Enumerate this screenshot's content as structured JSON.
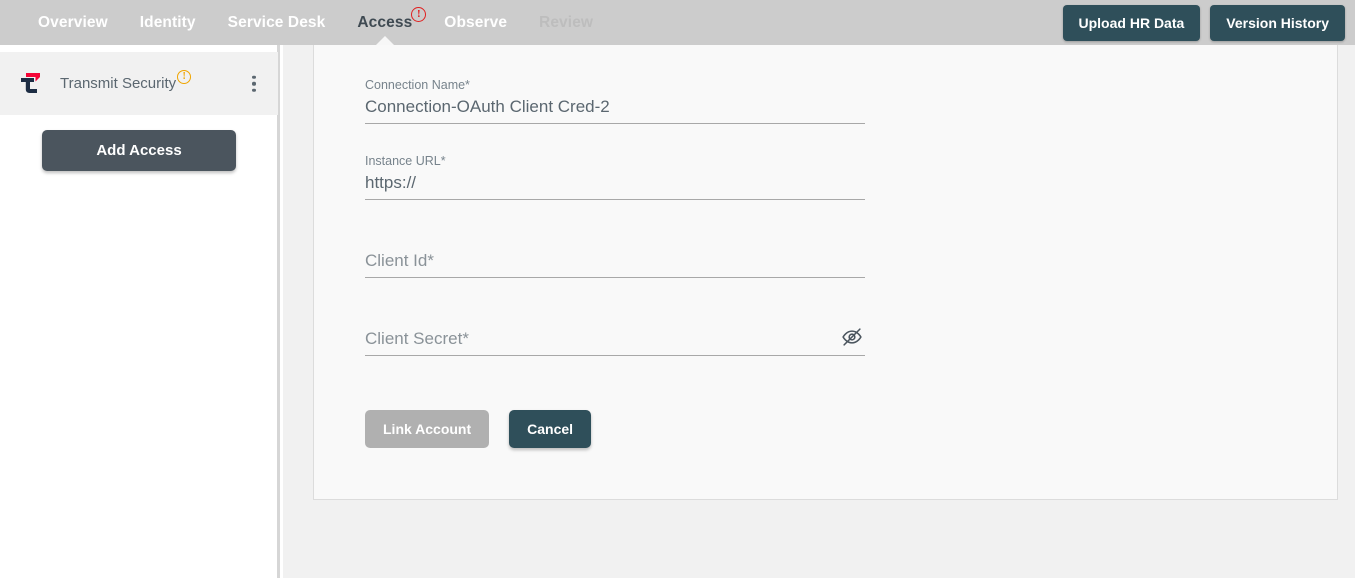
{
  "header": {
    "tabs": [
      {
        "label": "Overview",
        "state": "normal",
        "badge": null
      },
      {
        "label": "Identity",
        "state": "normal",
        "badge": null
      },
      {
        "label": "Service Desk",
        "state": "normal",
        "badge": null
      },
      {
        "label": "Access",
        "state": "active",
        "badge": "!"
      },
      {
        "label": "Observe",
        "state": "normal",
        "badge": null
      },
      {
        "label": "Review",
        "state": "muted",
        "badge": null
      }
    ],
    "upload_hr_data_label": "Upload HR Data",
    "version_history_label": "Version History",
    "background_color": "#cccccc",
    "button_color": "#2f4f5a",
    "active_tab_color": "#3f4a52",
    "badge_color": "#e02020"
  },
  "sidebar": {
    "connection": {
      "name": "Transmit Security",
      "badge": "!",
      "badge_color": "#f0a500",
      "menu_icon": "kebab-menu-icon"
    },
    "add_access_label": "Add Access",
    "add_access_color": "#4b555e"
  },
  "form": {
    "fields": [
      {
        "label": "Connection Name*",
        "value": "Connection-OAuth Client Cred-2",
        "placeholder": "",
        "filled": true,
        "has_label_above": true,
        "has_reveal_toggle": false
      },
      {
        "label": "Instance URL*",
        "value": "https://",
        "placeholder": "",
        "filled": true,
        "has_label_above": true,
        "has_reveal_toggle": false
      },
      {
        "label": "",
        "value": "",
        "placeholder": "Client Id*",
        "filled": false,
        "has_label_above": false,
        "has_reveal_toggle": false
      },
      {
        "label": "",
        "value": "",
        "placeholder": "Client Secret*",
        "filled": false,
        "has_label_above": false,
        "has_reveal_toggle": true
      }
    ],
    "link_account_label": "Link Account",
    "link_account_enabled": false,
    "cancel_label": "Cancel",
    "reveal_icon": "eye-off-icon"
  }
}
